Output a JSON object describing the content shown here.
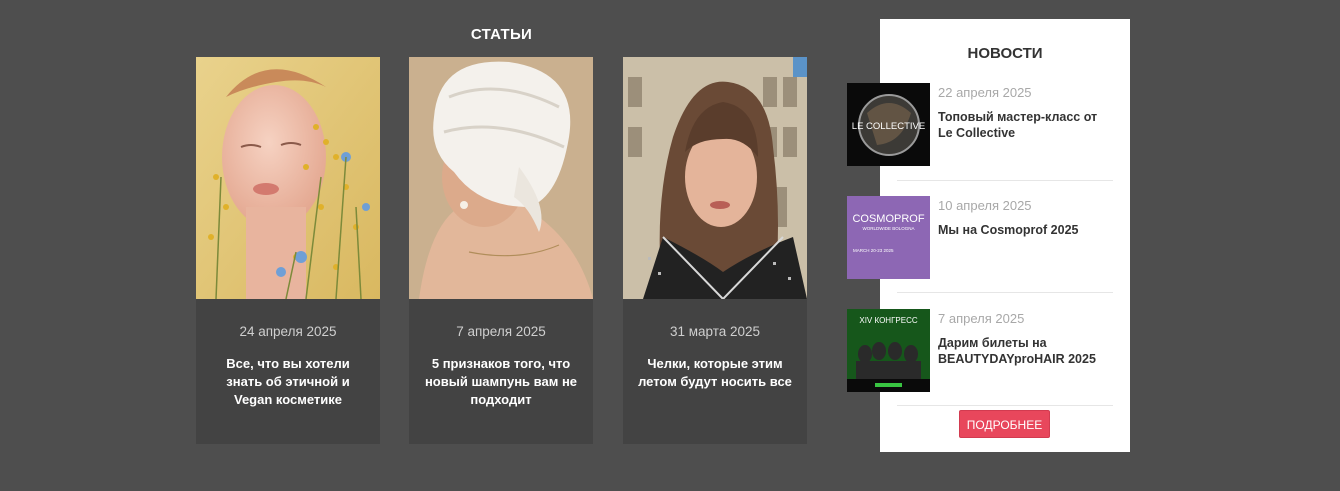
{
  "articles": {
    "heading": "СТАТЬИ",
    "items": [
      {
        "date": "24 апреля 2025",
        "title": "Все, что вы хотели знать об этичной и Vegan косметике"
      },
      {
        "date": "7 апреля 2025",
        "title": "5 признаков того, что новый шампунь вам не подходит"
      },
      {
        "date": "31 марта 2025",
        "title": "Челки, которые этим летом будут носить все"
      }
    ]
  },
  "news": {
    "heading": "НОВОСТИ",
    "items": [
      {
        "date": "22 апреля 2025",
        "title": "Топовый мастер-класс от Le Collective",
        "thumb_text": "LE COLLECTIVE"
      },
      {
        "date": "10 апреля 2025",
        "title": "Мы на Cosmoprof 2025",
        "thumb_text": "COSMOPROF",
        "thumb_sub": "WORLDWIDE BOLOGNA",
        "thumb_date": "MARCH 20-23 2025"
      },
      {
        "date": "7 апреля 2025",
        "title": "Дарим билеты на BEAUTYDAYproHAIR 2025",
        "thumb_text": "XIV КОНГРЕСС"
      }
    ],
    "more_button": "ПОДРОБНЕЕ"
  },
  "colors": {
    "background": "#4e4e4e",
    "card": "#434343",
    "accent": "#e8475c"
  }
}
